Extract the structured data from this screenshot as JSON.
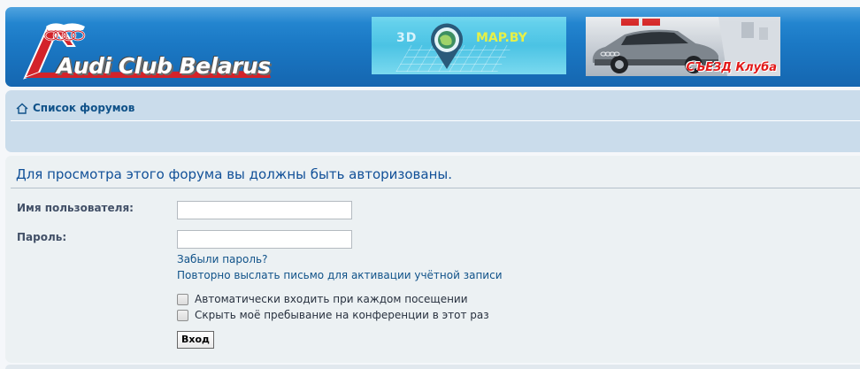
{
  "header": {
    "logo_text": "Audi Club Belarus",
    "banner_map": {
      "left_text": "3D",
      "right_text": "MAP.BY"
    },
    "banner_congress": {
      "caption": "СЪЕЗД Клуба"
    }
  },
  "nav": {
    "home_icon": "home-icon",
    "breadcrumb_label": "Список форумов"
  },
  "login": {
    "title": "Для просмотра этого форума вы должны быть авторизованы.",
    "username_label": "Имя пользователя:",
    "username_value": "",
    "password_label": "Пароль:",
    "password_value": "",
    "forgot_password_link": "Забыли пароль?",
    "resend_activation_link": "Повторно выслать письмо для активации учётной записи",
    "autologin_label": "Автоматически входить при каждом посещении",
    "autologin_checked": false,
    "hide_presence_label": "Скрыть моё пребывание на конференции в этот раз",
    "hide_presence_checked": false,
    "submit_label": "Вход"
  },
  "colors": {
    "header_blue": "#1b79c5",
    "nav_bg": "#cadceb",
    "panel_bg": "#ecf1f3",
    "link": "#105289",
    "title": "#115098",
    "logo_red": "#d3232a"
  }
}
